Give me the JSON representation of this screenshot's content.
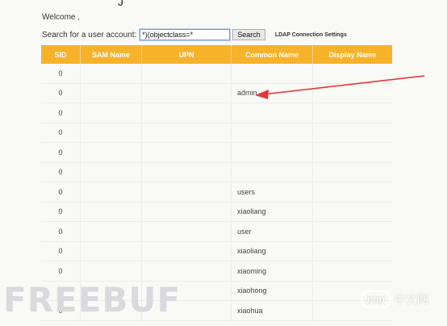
{
  "header": {
    "top_glyph": "J",
    "welcome": "Welcome ,"
  },
  "search": {
    "label": "Search for a user account:",
    "value": "*)(objectclass=*",
    "button": "Search",
    "ldap_link": "LDAP Connection Settings"
  },
  "table": {
    "columns": [
      "SID",
      "SAM Name",
      "UPN",
      "Common Name",
      "Display Name"
    ],
    "rows": [
      {
        "sid": "0",
        "sam": "",
        "upn": "",
        "cn": "",
        "dn": ""
      },
      {
        "sid": "0",
        "sam": "",
        "upn": "",
        "cn": "admin",
        "dn": ""
      },
      {
        "sid": "0",
        "sam": "",
        "upn": "",
        "cn": "",
        "dn": ""
      },
      {
        "sid": "0",
        "sam": "",
        "upn": "",
        "cn": "",
        "dn": ""
      },
      {
        "sid": "0",
        "sam": "",
        "upn": "",
        "cn": "",
        "dn": ""
      },
      {
        "sid": "0",
        "sam": "",
        "upn": "",
        "cn": "",
        "dn": ""
      },
      {
        "sid": "0",
        "sam": "",
        "upn": "",
        "cn": "users",
        "dn": ""
      },
      {
        "sid": "0",
        "sam": "",
        "upn": "",
        "cn": "xiaoliang",
        "dn": ""
      },
      {
        "sid": "0",
        "sam": "",
        "upn": "",
        "cn": "user",
        "dn": ""
      },
      {
        "sid": "0",
        "sam": "",
        "upn": "",
        "cn": "xiaoliang",
        "dn": ""
      },
      {
        "sid": "0",
        "sam": "",
        "upn": "",
        "cn": "xiaoming",
        "dn": ""
      },
      {
        "sid": "0",
        "sam": "",
        "upn": "",
        "cn": "xiaohong",
        "dn": ""
      },
      {
        "sid": "0",
        "sam": "",
        "upn": "",
        "cn": "xiaohua",
        "dn": ""
      }
    ]
  },
  "annotation": {
    "arrow_color": "#e03a3a"
  },
  "watermarks": {
    "left": "FREEBUF",
    "right_pill": "php",
    "right_text": "中文网"
  },
  "colors": {
    "header_bg": "#f6b22a",
    "header_text": "#ffffff",
    "page_bg": "#f9f9f5"
  }
}
